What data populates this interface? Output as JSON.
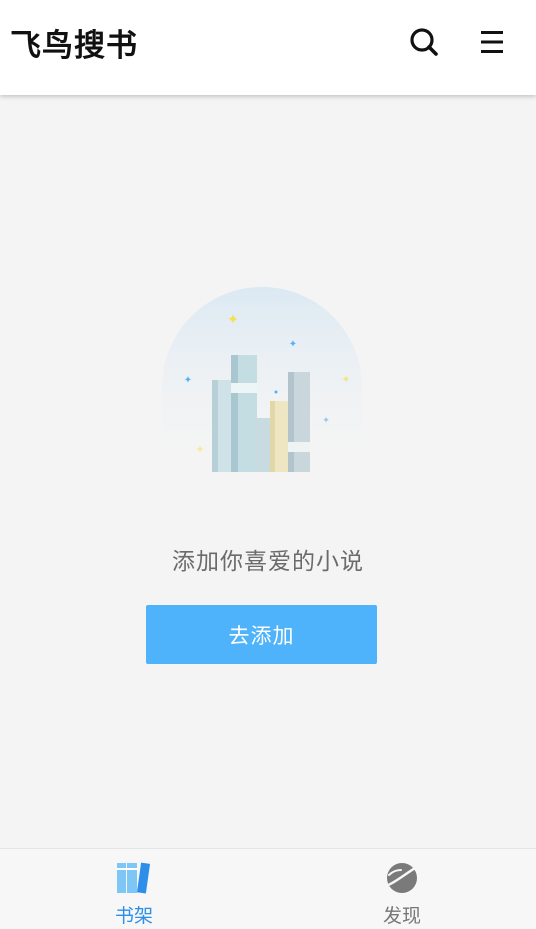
{
  "header": {
    "title": "飞鸟搜书",
    "search_icon": "search-icon",
    "menu_icon": "menu-icon"
  },
  "empty_state": {
    "illustration": "books-illustration",
    "message": "添加你喜爱的小说",
    "add_button_label": "去添加"
  },
  "tabbar": {
    "tabs": [
      {
        "label": "书架",
        "icon": "bookshelf-icon",
        "active": true,
        "color": "#2e8fea"
      },
      {
        "label": "发现",
        "icon": "planet-icon",
        "active": false,
        "color": "#777777"
      }
    ]
  },
  "colors": {
    "accent": "#4fb3fb",
    "background": "#f4f4f4",
    "header_bg": "#ffffff"
  }
}
